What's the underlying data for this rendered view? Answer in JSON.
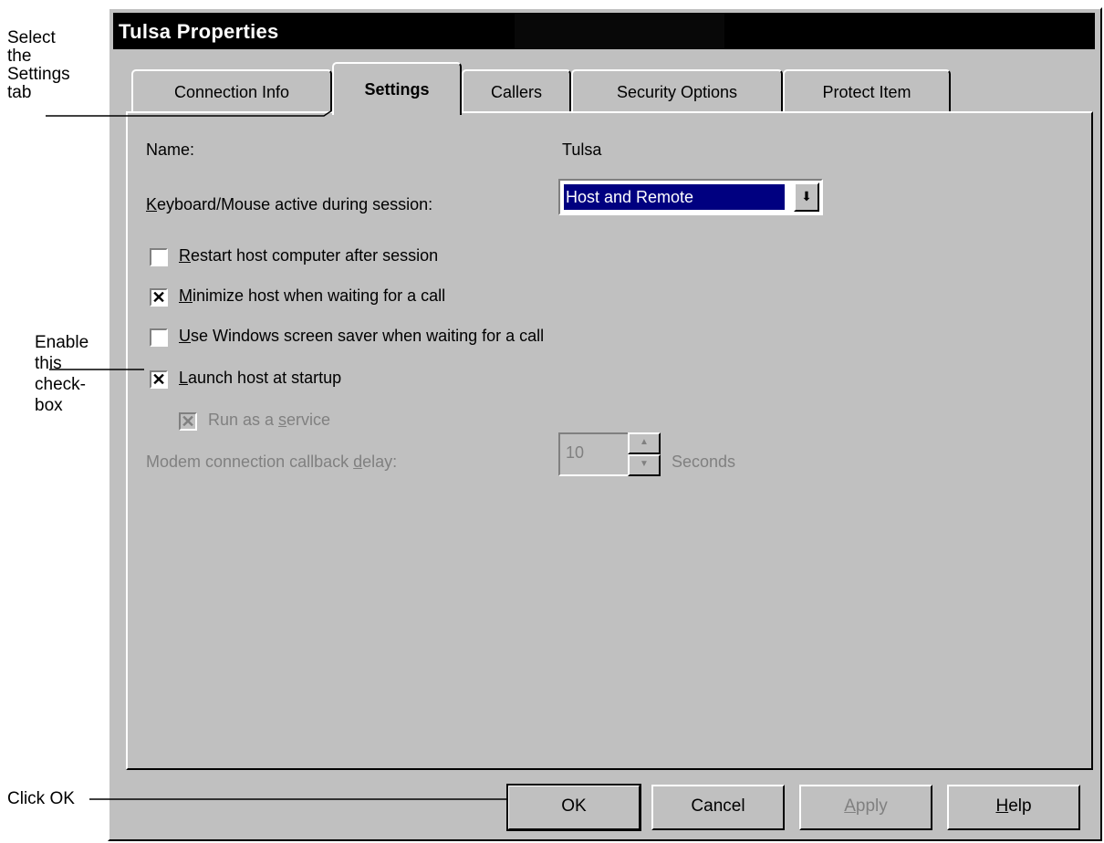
{
  "callouts": {
    "settings_tab": [
      "Select",
      "the",
      "Settings",
      "tab"
    ],
    "checkbox": [
      "Enable",
      "this",
      "check-",
      "box"
    ],
    "ok": "Click OK"
  },
  "dialog": {
    "title": "Tulsa Properties",
    "tabs": [
      "Connection Info",
      "Settings",
      "Callers",
      "Security Options",
      "Protect Item"
    ],
    "active_tab": "Settings"
  },
  "settings": {
    "name_label": "Name:",
    "name_value": "Tulsa",
    "keyboard_label_pre": "",
    "keyboard_label_u": "K",
    "keyboard_label_post": "eyboard/Mouse active during session:",
    "keyboard_value": "Host and Remote",
    "checkboxes": [
      {
        "u": "R",
        "rest": "estart host computer after session",
        "checked": false
      },
      {
        "u": "M",
        "rest": "inimize host when waiting for a call",
        "checked": true
      },
      {
        "u": "U",
        "rest": "se Windows screen saver when waiting for a call",
        "checked": false
      },
      {
        "u": "L",
        "rest": "aunch host at startup",
        "checked": true
      }
    ],
    "service_pre": "Run as a ",
    "service_u": "s",
    "service_post": "ervice",
    "service_checked": true,
    "delay_pre": "Modem connection callback ",
    "delay_u": "d",
    "delay_post": "elay:",
    "delay_value": "10",
    "delay_unit": "Seconds"
  },
  "buttons": {
    "ok": "OK",
    "cancel": "Cancel",
    "apply_u": "A",
    "apply_rest": "pply",
    "help_u": "H",
    "help_rest": "elp"
  },
  "check_mark": "✕",
  "arrow_glyph": "⬇",
  "up_glyph": "▲",
  "down_glyph": "▼"
}
